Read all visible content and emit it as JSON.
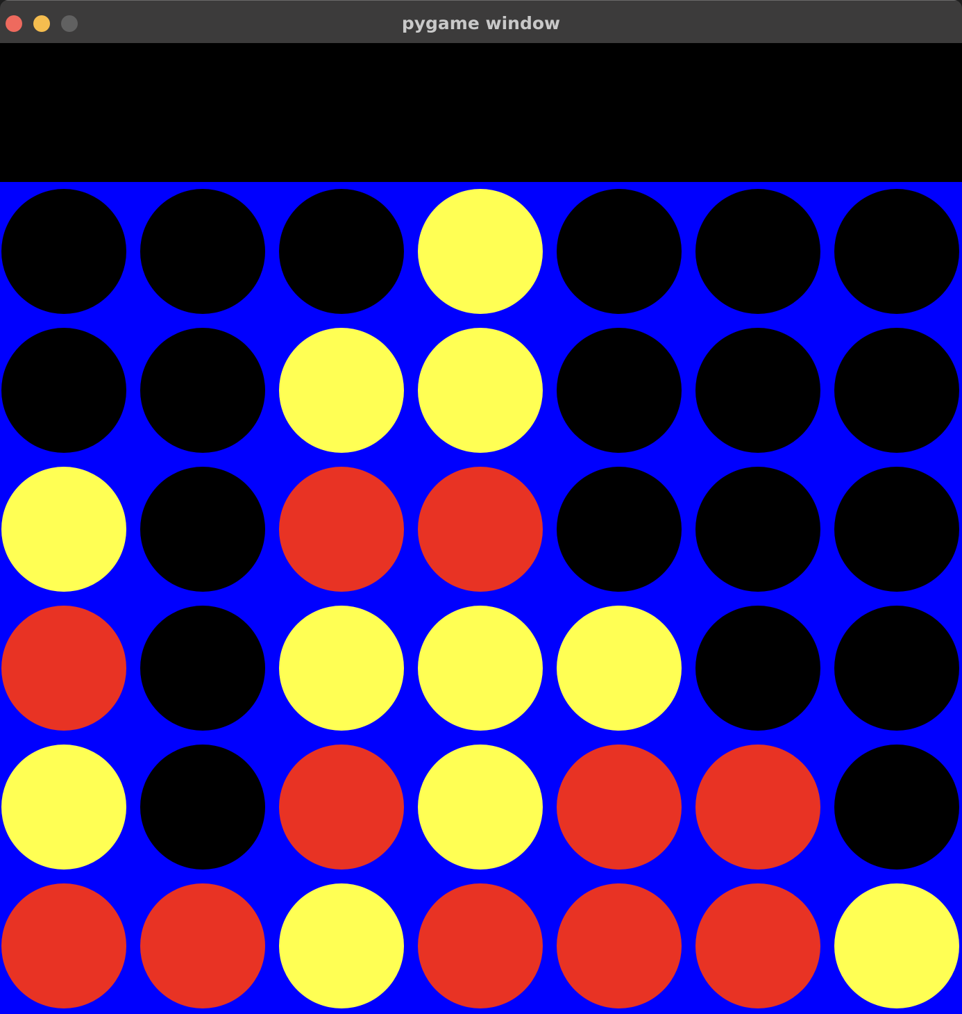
{
  "window": {
    "title": "pygame window"
  },
  "colors": {
    "titlebar": "#3c3b3b",
    "board": "#0000fe",
    "empty": "#000000",
    "red": "#e83324",
    "yellow": "#ffff54"
  },
  "game": {
    "rows": 6,
    "columns": 7,
    "board": [
      [
        "empty",
        "empty",
        "empty",
        "yellow",
        "empty",
        "empty",
        "empty"
      ],
      [
        "empty",
        "empty",
        "yellow",
        "yellow",
        "empty",
        "empty",
        "empty"
      ],
      [
        "yellow",
        "empty",
        "red",
        "red",
        "empty",
        "empty",
        "empty"
      ],
      [
        "red",
        "empty",
        "yellow",
        "yellow",
        "yellow",
        "empty",
        "empty"
      ],
      [
        "yellow",
        "empty",
        "red",
        "yellow",
        "red",
        "red",
        "empty"
      ],
      [
        "red",
        "red",
        "yellow",
        "red",
        "red",
        "red",
        "yellow"
      ]
    ]
  }
}
